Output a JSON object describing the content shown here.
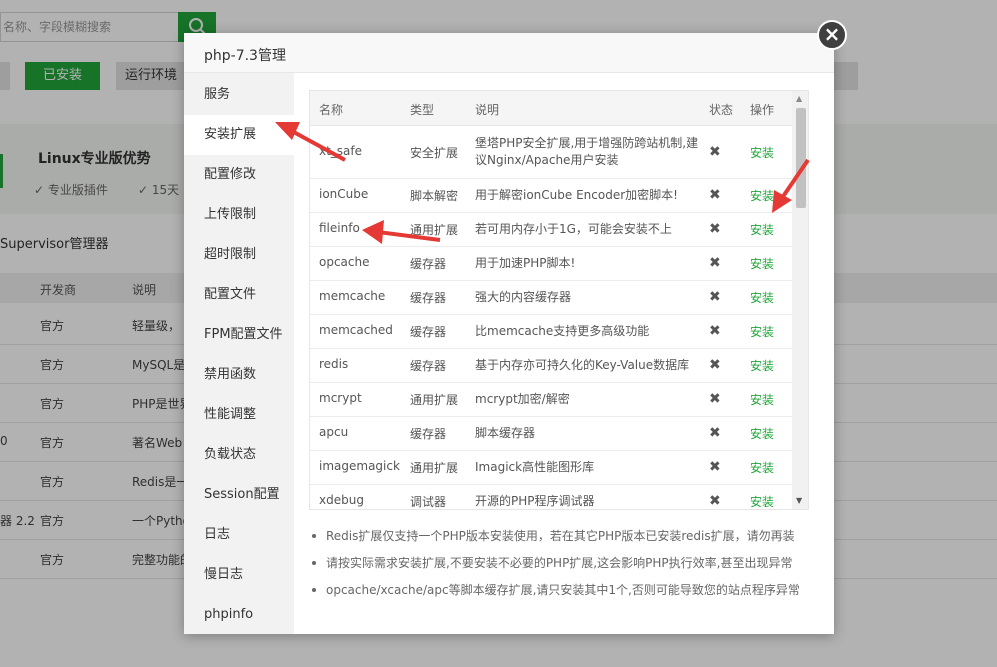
{
  "background": {
    "search_placeholder": "名称、字段模糊搜索",
    "tabs": [
      {
        "label": "",
        "kind": "gray"
      },
      {
        "label": "已安装",
        "kind": "green"
      },
      {
        "label": "运行环境",
        "kind": "gray"
      }
    ],
    "promo_title": "Linux专业版优势",
    "promo_items": [
      "✓ 专业版插件",
      "✓ 15天"
    ],
    "supervisor_label": "Supervisor管理器",
    "table_headers": [
      "开发商",
      "说明"
    ],
    "rows": [
      {
        "left": "",
        "dev": "官方",
        "desc": "轻量级，"
      },
      {
        "left": "",
        "dev": "官方",
        "desc": "MySQL是"
      },
      {
        "left": "",
        "dev": "官方",
        "desc": "PHP是世界"
      },
      {
        "left": "0",
        "dev": "官方",
        "desc": "著名Web"
      },
      {
        "left": "",
        "dev": "官方",
        "desc": "Redis是一"
      },
      {
        "left": "器 2.2",
        "dev": "官方",
        "desc": "一个Pytho"
      },
      {
        "left": "",
        "dev": "官方",
        "desc": "完整功能的"
      }
    ]
  },
  "dialog": {
    "title": "php-7.3管理",
    "close_symbol": "×",
    "side_menu": [
      "服务",
      "安装扩展",
      "配置修改",
      "上传限制",
      "超时限制",
      "配置文件",
      "FPM配置文件",
      "禁用函数",
      "性能调整",
      "负载状态",
      "Session配置",
      "日志",
      "慢日志",
      "phpinfo"
    ],
    "active_menu": "安装扩展",
    "table": {
      "headers": [
        "名称",
        "类型",
        "说明",
        "状态",
        "操作"
      ],
      "rows": [
        {
          "name": "xt_safe",
          "type": "安全扩展",
          "desc": "堡塔PHP安全扩展,用于增强防跨站机制,建议Nginx/Apache用户安装",
          "status": "✖",
          "action": "安装"
        },
        {
          "name": "ionCube",
          "type": "脚本解密",
          "desc": "用于解密ionCube Encoder加密脚本!",
          "status": "✖",
          "action": "安装"
        },
        {
          "name": "fileinfo",
          "type": "通用扩展",
          "desc": "若可用内存小于1G，可能会安装不上",
          "status": "✖",
          "action": "安装"
        },
        {
          "name": "opcache",
          "type": "缓存器",
          "desc": "用于加速PHP脚本!",
          "status": "✖",
          "action": "安装"
        },
        {
          "name": "memcache",
          "type": "缓存器",
          "desc": "强大的内容缓存器",
          "status": "✖",
          "action": "安装"
        },
        {
          "name": "memcached",
          "type": "缓存器",
          "desc": "比memcache支持更多高级功能",
          "status": "✖",
          "action": "安装"
        },
        {
          "name": "redis",
          "type": "缓存器",
          "desc": "基于内存亦可持久化的Key-Value数据库",
          "status": "✖",
          "action": "安装"
        },
        {
          "name": "mcrypt",
          "type": "通用扩展",
          "desc": "mcrypt加密/解密",
          "status": "✖",
          "action": "安装"
        },
        {
          "name": "apcu",
          "type": "缓存器",
          "desc": "脚本缓存器",
          "status": "✖",
          "action": "安装"
        },
        {
          "name": "imagemagick",
          "type": "通用扩展",
          "desc": "Imagick高性能图形库",
          "status": "✖",
          "action": "安装"
        },
        {
          "name": "xdebug",
          "type": "调试器",
          "desc": "开源的PHP程序调试器",
          "status": "✖",
          "action": "安装"
        }
      ]
    },
    "notes": [
      "Redis扩展仅支持一个PHP版本安装使用，若在其它PHP版本已安装redis扩展，请勿再装",
      "请按实际需求安装扩展,不要安装不必要的PHP扩展,这会影响PHP执行效率,甚至出现异常",
      "opcache/xcache/apc等脚本缓存扩展,请只安装其中1个,否则可能导致您的站点程序异常"
    ]
  },
  "colors": {
    "accent": "#20a53a",
    "arrow": "#e53935"
  }
}
